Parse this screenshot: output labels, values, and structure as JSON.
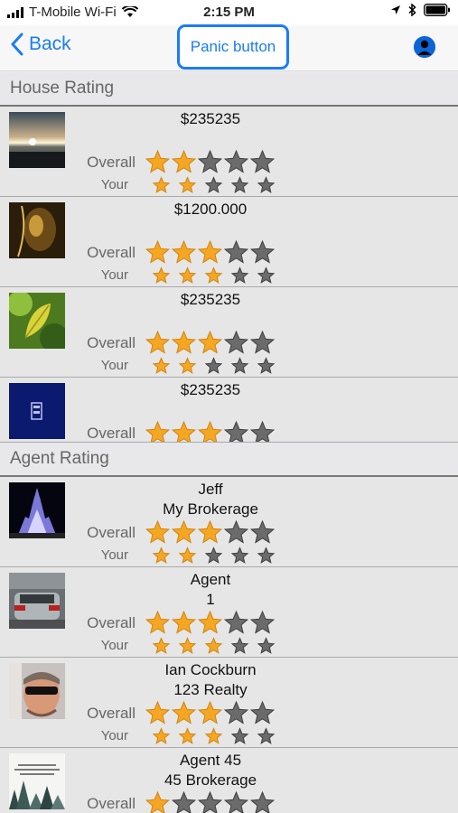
{
  "status": {
    "carrier": "T-Mobile Wi-Fi",
    "time": "2:15 PM"
  },
  "nav": {
    "back_label": "Back",
    "panic_label": "Panic button"
  },
  "house_section": {
    "title": "House Rating"
  },
  "agent_section": {
    "title": "Agent Rating"
  },
  "labels": {
    "overall": "Overall",
    "your": "Your"
  },
  "houses": [
    {
      "price": "$235235",
      "overall": 2,
      "your": 2,
      "thumb": "sunset"
    },
    {
      "price": "$1200.000",
      "overall": 3,
      "your": 3,
      "thumb": "gold"
    },
    {
      "price": "$235235",
      "overall": 3,
      "your": 2,
      "thumb": "leaf"
    },
    {
      "price": "$235235",
      "overall": 3,
      "your": null,
      "thumb": "navy"
    }
  ],
  "agents": [
    {
      "name": "Jeff",
      "brokerage": "My Brokerage",
      "overall": 3,
      "your": 2,
      "thumb": "castle"
    },
    {
      "name": "Agent",
      "brokerage": "1",
      "overall": 3,
      "your": 3,
      "thumb": "car"
    },
    {
      "name": "Ian Cockburn",
      "brokerage": "123 Realty",
      "overall": 3,
      "your": 3,
      "thumb": "face"
    },
    {
      "name": "Agent 45",
      "brokerage": "45 Brokerage",
      "overall": 1,
      "your": null,
      "thumb": "forest"
    }
  ],
  "colors": {
    "accent": "#1a7cf5",
    "star_filled": "#f5a623",
    "star_empty": "#6b6b6b"
  }
}
